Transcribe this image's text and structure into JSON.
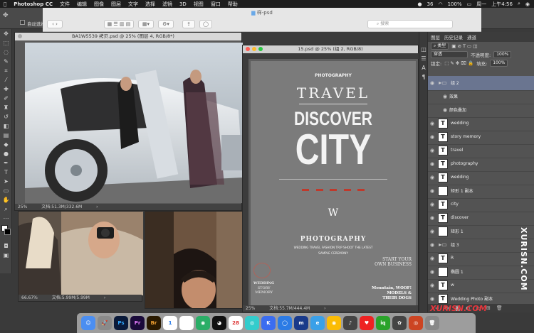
{
  "menubar": {
    "app": "Photoshop CC",
    "items": [
      "文件",
      "编辑",
      "图像",
      "图层",
      "文字",
      "选择",
      "滤镜",
      "3D",
      "视图",
      "窗口",
      "帮助"
    ],
    "status": {
      "notifications": "36",
      "battery": "100%",
      "day": "周一",
      "time": "上午4:56"
    }
  },
  "finder": {
    "title": "样-psd",
    "search_placeholder": "搜索"
  },
  "options": {
    "auto_select": "自动选择"
  },
  "doc1": {
    "tab": "BA1W5539 拷贝.psd @ 25% (图层 4, RGB/8*)",
    "zoom": "25%",
    "docsize": "文档:51.3M/332.6M"
  },
  "doc2": {
    "zoom": "66.67%",
    "docsize": "文档:5.99M/5.99M"
  },
  "doc3": {
    "tab": "15.psd @ 25% (组 2, RGB/8)",
    "zoom": "25%",
    "docsize": "文档:55.7M/444.4M"
  },
  "poster": {
    "brand_top": "PHOTOGRAPHY",
    "travel": "TRAVEL",
    "discover": "DISCOVER",
    "city": "CITY",
    "photography": "PHOTOGRAPHY",
    "sub1": "WEDDING TRAVEL FASHION TRIP SHOOT THE LATEST",
    "sub2": "SAMPLE CEREMONY",
    "wedding_story": [
      "WEDDING",
      "STORY",
      "MEMORY"
    ],
    "start_business": [
      "START YOUR",
      "OWN BUSINESS"
    ],
    "woof": "Mountain, WOOF!",
    "models": [
      "MODELS &",
      "THEIR DOGS"
    ]
  },
  "panel": {
    "tabs": [
      "图层",
      "历史记录",
      "通道"
    ],
    "kind": "类型",
    "blend": "穿透",
    "opacity_label": "不透明度:",
    "opacity": "100%",
    "lock_label": "锁定:",
    "fill_label": "填充:",
    "fill": "100%",
    "layers": [
      {
        "name": "组 2",
        "type": "folder",
        "active": true
      },
      {
        "name": "效果",
        "type": "fx"
      },
      {
        "name": "颜色叠加",
        "type": "fx"
      },
      {
        "name": "wedding",
        "type": "text"
      },
      {
        "name": "story memory",
        "type": "text"
      },
      {
        "name": "travel",
        "type": "text"
      },
      {
        "name": "photography",
        "type": "text"
      },
      {
        "name": "wedding",
        "type": "text"
      },
      {
        "name": "矩形 1 副本",
        "type": "shape"
      },
      {
        "name": "city",
        "type": "text"
      },
      {
        "name": "discover",
        "type": "text"
      },
      {
        "name": "矩形 1",
        "type": "shape"
      },
      {
        "name": "组 3",
        "type": "folder"
      },
      {
        "name": "R",
        "type": "text"
      },
      {
        "name": "椭圆 1",
        "type": "shape"
      },
      {
        "name": "w",
        "type": "text"
      },
      {
        "name": "Wedding Photo 副本",
        "type": "text"
      }
    ]
  },
  "watermark": "XURISN.COM",
  "dock": [
    "Fi",
    "Ps",
    "Pr",
    "Br",
    "Ae"
  ]
}
